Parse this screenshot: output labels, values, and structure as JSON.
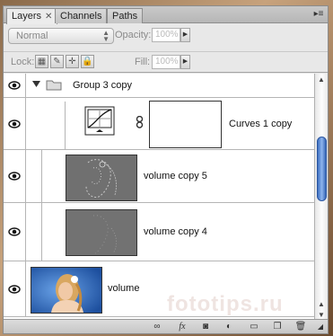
{
  "tabs": [
    {
      "label": "Layers",
      "close": "✕"
    },
    {
      "label": "Channels"
    },
    {
      "label": "Paths"
    }
  ],
  "panel_menu_icon": "panel-menu-icon",
  "blend_mode": "Normal",
  "opacity": {
    "label": "Opacity:",
    "value": "100%"
  },
  "lock_label": "Lock:",
  "fill": {
    "label": "Fill:",
    "value": "100%"
  },
  "layers": [
    {
      "name": "Group 3 copy",
      "type": "group"
    },
    {
      "name": "Curves 1 copy",
      "type": "adjustment"
    },
    {
      "name": "volume copy 5",
      "type": "pixel"
    },
    {
      "name": "volume copy 4",
      "type": "pixel"
    },
    {
      "name": "volume",
      "type": "pixel"
    }
  ],
  "watermark": "fototips.ru",
  "colors": {
    "scroll_thumb": "#4f7fd0",
    "panel_bg": "#e8e8e8"
  }
}
